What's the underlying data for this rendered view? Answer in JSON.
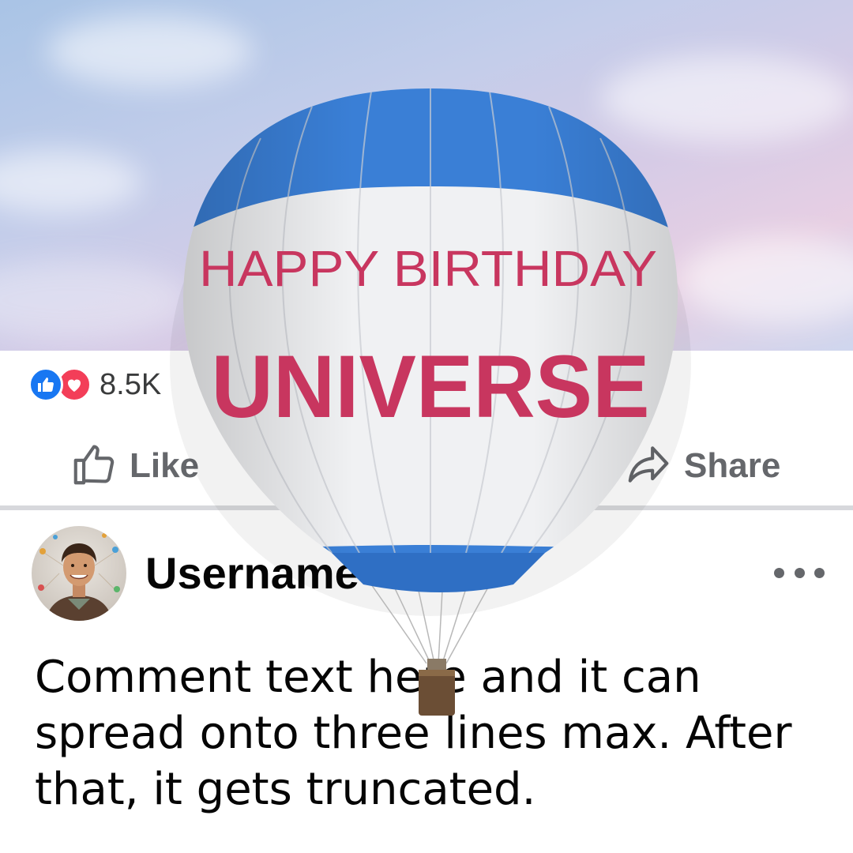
{
  "balloon": {
    "line1": "HAPPY BIRTHDAY",
    "line2": "UNIVERSE"
  },
  "reactions": {
    "icons": [
      "like-reaction-icon",
      "love-reaction-icon"
    ],
    "count": "8.5K"
  },
  "actions": {
    "like_label": "Like",
    "share_label": "Share"
  },
  "comment": {
    "username": "Username",
    "text": "Comment text here and it can spread onto three lines max. After that, it gets truncated.",
    "more_icon": "ellipsis-icon"
  },
  "colors": {
    "facebook_blue": "#1877f2",
    "love_red": "#f33e58",
    "balloon_blue": "#3a7fd6",
    "balloon_text_pink": "#c8365f",
    "muted_gray": "#65676b"
  }
}
